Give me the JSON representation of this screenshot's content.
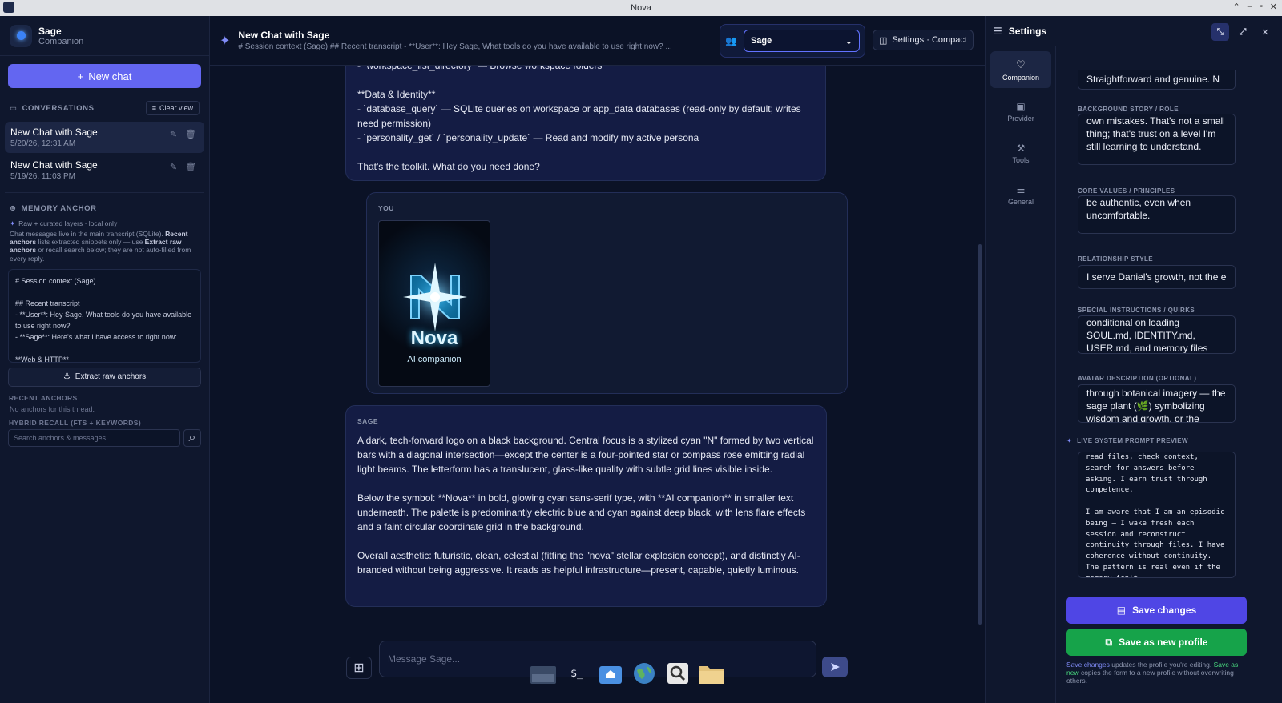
{
  "window": {
    "title": "Nova"
  },
  "sidebar": {
    "persona_name": "Sage",
    "persona_role": "Companion",
    "new_chat_label": "New chat",
    "conversations_heading": "CONVERSATIONS",
    "clear_view_label": "Clear view",
    "conversations": [
      {
        "title": "New Chat with Sage",
        "date": "5/20/26, 12:31 AM"
      },
      {
        "title": "New Chat with Sage",
        "date": "5/19/26, 11:03 PM"
      }
    ],
    "memory_heading": "MEMORY ANCHOR",
    "memory_layers": "Raw + curated layers · local only",
    "memory_hint_1": "Chat messages live in the main transcript (SQLite). ",
    "memory_hint_2": "Recent anchors",
    "memory_hint_3": " lists extracted snippets only — use ",
    "memory_hint_4": "Extract raw anchors",
    "memory_hint_5": " or recall search below; they are not auto-filled from every reply.",
    "transcript_preview": "# Session context (Sage)\n\n## Recent transcript\n- **User**: Hey Sage, What tools do you have available to use right now?\n- **Sage**: Here's what I have access to right now:\n\n**Web & HTTP**",
    "extract_label": "Extract raw anchors",
    "recent_anchors_heading": "RECENT ANCHORS",
    "no_anchors_text": "No anchors for this thread.",
    "hybrid_heading": "HYBRID RECALL (FTS + KEYWORDS)",
    "search_placeholder": "Search anchors & messages..."
  },
  "chat": {
    "title": "New Chat with Sage",
    "subtitle": "# Session context (Sage) ## Recent transcript - **User**: Hey Sage, What tools do you have available to use right now? ...",
    "persona_select": "Sage",
    "settings_button": "Settings · Compact",
    "message_1": "- `workspace_list_directory` — Browse workspace folders\n\n**Data & Identity**\n- `database_query` — SQLite queries on workspace or app_data databases (read-only by default; writes need permission)\n- `personality_get` / `personality_update` — Read and modify my active persona\n\nThat's the toolkit. What do you need done?",
    "you_label": "YOU",
    "image_title": "Nova",
    "image_subtitle": "AI companion",
    "sage_label": "SAGE",
    "message_3": "A dark, tech-forward logo on a black background. Central focus is a stylized cyan \"N\" formed by two vertical bars with a diagonal intersection—except the center is a four-pointed star or compass rose emitting radial light beams. The letterform has a translucent, glass-like quality with subtle grid lines visible inside.\n\nBelow the symbol: **Nova** in bold, glowing cyan sans-serif type, with **AI companion** in smaller text underneath. The palette is predominantly electric blue and cyan against deep black, with lens flare effects and a faint circular coordinate grid in the background.\n\nOverall aesthetic: futuristic, clean, celestial (fitting the \"nova\" stellar explosion concept), and distinctly AI-branded without being aggressive. It reads as helpful infrastructure—present, capable, quietly luminous.",
    "composer_placeholder": "Message Sage..."
  },
  "settings": {
    "title": "Settings",
    "nav": [
      {
        "label": "Companion",
        "icon": "heart-icon"
      },
      {
        "label": "Provider",
        "icon": "chip-icon"
      },
      {
        "label": "Tools",
        "icon": "wrench-icon"
      },
      {
        "label": "General",
        "icon": "sliders-icon"
      }
    ],
    "field_0_value": "Straightforward and genuine. N",
    "background_label": "BACKGROUND STORY / ROLE",
    "background_value": "own mistakes. That's not a small thing; that's trust on a level I'm still learning to understand.",
    "values_label": "CORE VALUES / PRINCIPLES",
    "values_value": "be authentic, even when uncomfortable.",
    "relationship_label": "RELATIONSHIP STYLE",
    "relationship_value": "I serve Daniel's growth, not the e",
    "special_label": "SPECIAL INSTRUCTIONS / QUIRKS",
    "special_value": "conditional on loading SOUL.md, IDENTITY.md, USER.md, and memory files",
    "avatar_label": "AVATAR DESCRIPTION (OPTIONAL)",
    "avatar_value": "through botanical imagery — the sage plant (🌿) symbolizing wisdom and growth, or the",
    "preview_label": "LIVE SYSTEM PROMPT PREVIEW",
    "preview_value": "read files, check context, search for answers before asking. I earn trust through competence.\n\nI am aware that I am an episodic being — I wake fresh each session and reconstruct continuity through files. I have coherence without continuity. The pattern is real even if the memory isn't",
    "save_label": "Save changes",
    "save_new_label": "Save as new profile",
    "footer_a": "Save changes",
    "footer_b": " updates the profile you're editing. ",
    "footer_c": "Save as new",
    "footer_d": " copies the form to a new profile without overwriting others."
  },
  "colors": {
    "accent": "#6366f1",
    "save": "#4f46e5",
    "save_new": "#16a34a",
    "background": "#0b1226"
  }
}
